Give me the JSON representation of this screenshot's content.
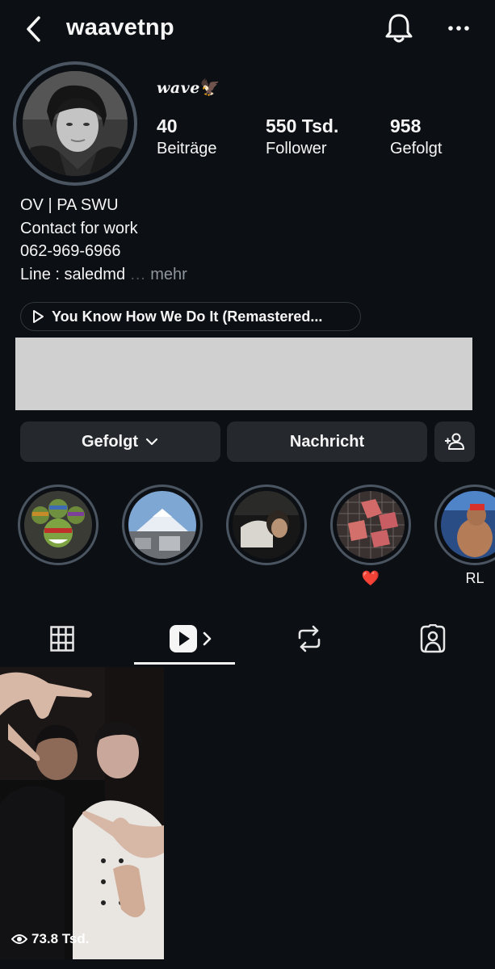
{
  "header": {
    "username": "waavetnp"
  },
  "profile": {
    "display_name": "wave",
    "display_name_emoji": "🦅",
    "stats": [
      {
        "value": "40",
        "label": "Beiträge"
      },
      {
        "value": "550 Tsd.",
        "label": "Follower"
      },
      {
        "value": "958",
        "label": "Gefolgt"
      }
    ],
    "bio_lines": [
      "OV | PA SWU",
      "Contact for work",
      "062-969-6966",
      "Line : saledmd"
    ],
    "bio_more": "mehr",
    "music": "You Know How We Do It (Remastered..."
  },
  "actions": {
    "following_label": "Gefolgt",
    "message_label": "Nachricht"
  },
  "highlights": [
    {
      "label": ""
    },
    {
      "label": ""
    },
    {
      "label": ""
    },
    {
      "label": "❤️"
    },
    {
      "label": "RL"
    }
  ],
  "tabs": [
    "grid",
    "reels",
    "reposts",
    "tagged"
  ],
  "active_tab": "reels",
  "reels": [
    {
      "views": "73.8 Tsd."
    }
  ],
  "colors": {
    "background": "#0c1014",
    "button": "#25292e",
    "ring": "#4a5561",
    "muted_text": "#8e959c"
  }
}
